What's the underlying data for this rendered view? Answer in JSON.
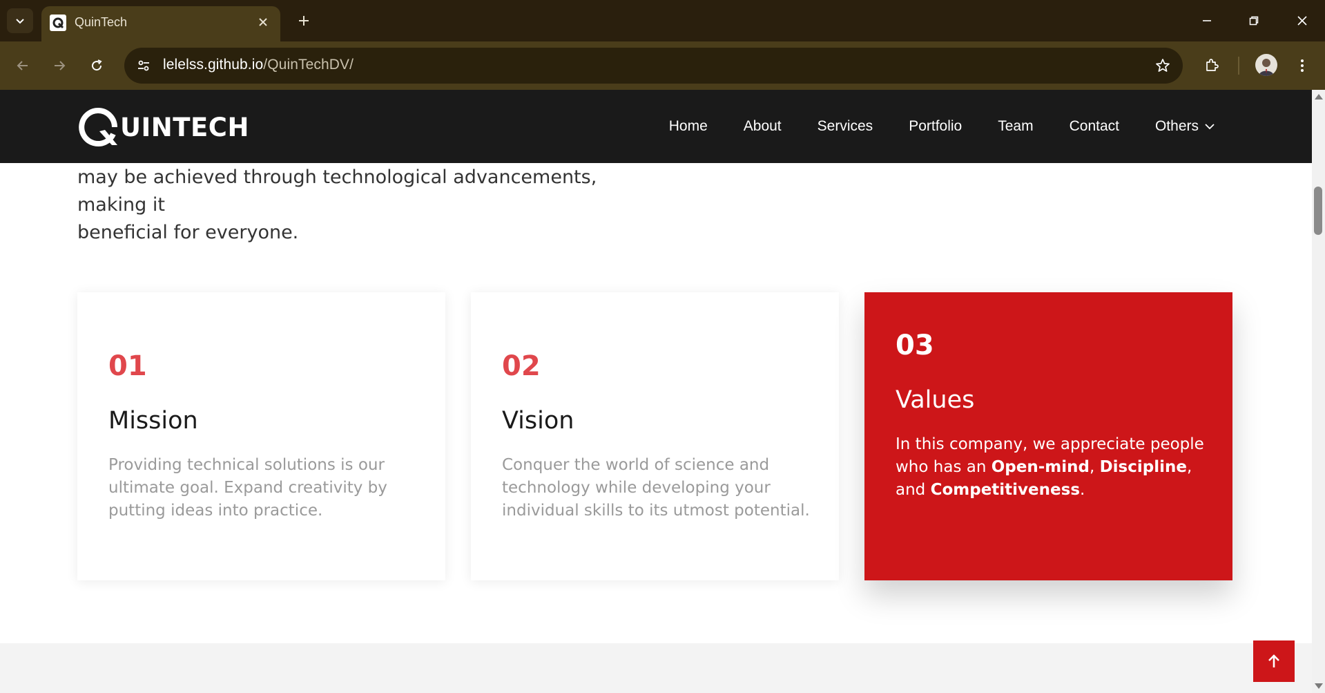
{
  "browser": {
    "tab_title": "QuinTech",
    "url_host": "lelelss.github.io",
    "url_path": "/QuinTechDV/"
  },
  "site": {
    "logo_text": "UINTECH",
    "nav": [
      "Home",
      "About",
      "Services",
      "Portfolio",
      "Team",
      "Contact",
      "Others"
    ]
  },
  "intro": {
    "line1": "may be achieved through technological advancements, making it",
    "line2": "beneficial for everyone."
  },
  "cards": [
    {
      "number": "01",
      "title": "Mission",
      "description": "Providing technical solutions is our ultimate goal. Expand creativity by putting ideas into practice."
    },
    {
      "number": "02",
      "title": "Vision",
      "description": "Conquer the world of science and technology while developing your individual skills to its utmost potential."
    },
    {
      "number": "03",
      "title": "Values",
      "desc_prefix": "In this company, we appreciate people who has an ",
      "desc_strong1": "Open-mind",
      "desc_sep1": ", ",
      "desc_strong2": "Discipline",
      "desc_sep2": ", and ",
      "desc_strong3": "Competitiveness",
      "desc_end": "."
    }
  ],
  "colors": {
    "accent_red": "#cd1619",
    "number_red": "#e0474c",
    "nav_bg": "#1a1a1a",
    "chrome_bg": "#4a3d1a"
  },
  "icons": [
    "tab-list-icon",
    "close-icon",
    "plus-icon",
    "minimize-icon",
    "restore-icon",
    "back-icon",
    "forward-icon",
    "reload-icon",
    "site-info-icon",
    "star-icon",
    "extensions-icon",
    "menu-icon",
    "chevron-down-icon",
    "arrow-up-icon"
  ]
}
